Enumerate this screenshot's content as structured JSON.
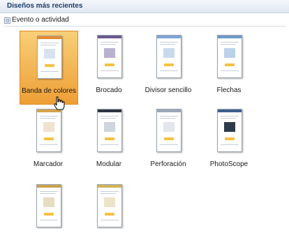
{
  "header": {
    "title": "Diseños más recientes"
  },
  "section": {
    "expander": "⊟",
    "label": "Evento o actividad"
  },
  "templates": [
    {
      "label": "Banda de colores",
      "accent": "#e88a2f",
      "selected": true
    },
    {
      "label": "Brocado",
      "accent": "#6a5a8c"
    },
    {
      "label": "Divisor sencillo",
      "accent": "#7fa6d6"
    },
    {
      "label": "Flechas",
      "accent": "#6c9ac9"
    },
    {
      "label": "Marcador",
      "accent": "#d8a24a"
    },
    {
      "label": "Modular",
      "accent": "#2f3540"
    },
    {
      "label": "Perforación",
      "accent": "#9aa7b5"
    },
    {
      "label": "PhotoScope",
      "accent": "#3c5f8a"
    },
    {
      "label": "",
      "accent": "#c9a24c"
    },
    {
      "label": "",
      "accent": "#d0b35a"
    }
  ]
}
